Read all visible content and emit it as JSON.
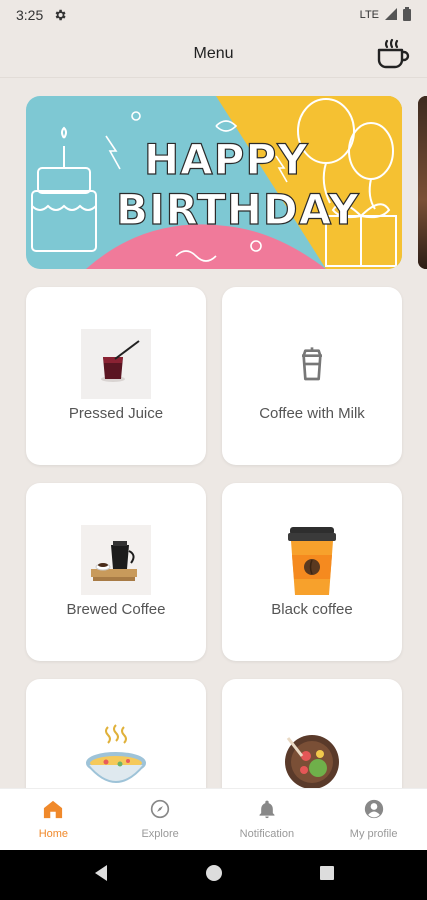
{
  "status_bar": {
    "time": "3:25",
    "network": "LTE"
  },
  "app_bar": {
    "title": "Menu"
  },
  "banner": {
    "line1": "HAPPY",
    "line2": "BIRTHDAY"
  },
  "menu_items": [
    {
      "label": "Pressed Juice"
    },
    {
      "label": "Coffee with Milk"
    },
    {
      "label": "Brewed Coffee"
    },
    {
      "label": "Black coffee"
    },
    {
      "label": ""
    },
    {
      "label": ""
    }
  ],
  "bottom_nav": {
    "home": "Home",
    "explore": "Explore",
    "notification": "Notification",
    "profile": "My profile"
  },
  "colors": {
    "accent": "#f0892b",
    "background": "#ede8e4"
  }
}
